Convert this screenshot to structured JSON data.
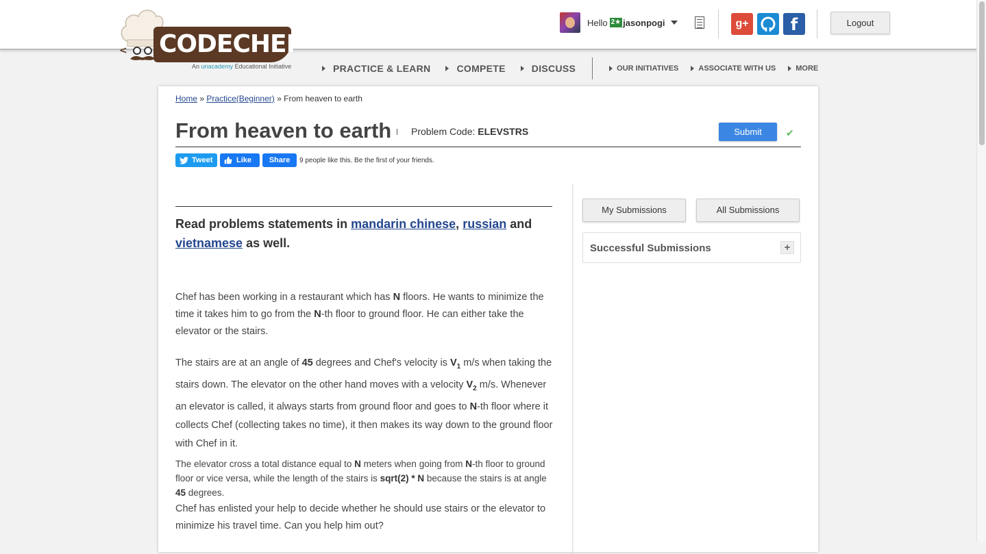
{
  "header": {
    "logo_text": "CODECHEF",
    "tagline_prefix": "An",
    "tagline_brand": "unacademy",
    "tagline_suffix": "Educational Initiative",
    "greeting": "Hello",
    "user_stars": "2★",
    "username": "jasonpogi",
    "logout_label": "Logout",
    "social": {
      "google": "g+",
      "facebook": "f"
    }
  },
  "nav": {
    "primary": [
      "PRACTICE & LEARN",
      "COMPETE",
      "DISCUSS"
    ],
    "secondary": [
      "OUR INITIATIVES",
      "ASSOCIATE WITH US",
      "MORE"
    ]
  },
  "breadcrumb": {
    "home": "Home",
    "sep1": "»",
    "practice": "Practice(Beginner)",
    "sep2": "»",
    "current": "From heaven to earth"
  },
  "problem": {
    "title": "From heaven to earth",
    "code_label": "Problem Code:",
    "code": "ELEVSTRS",
    "submit_label": "Submit"
  },
  "share": {
    "tweet": "Tweet",
    "like": "Like",
    "share": "Share",
    "likes_text": "9 people like this. Be the first of your friends."
  },
  "statement": {
    "read_prefix": "Read problems statements in",
    "lang1": "mandarin chinese",
    "comma": ",",
    "lang2": "russian",
    "and": "and",
    "lang3": "vietnamese",
    "suffix": "as well.",
    "p1": {
      "a": "Chef has been working in a restaurant which has ",
      "n1": "N",
      "b": " floors. He wants to minimize the time it takes him to go from the ",
      "n2": "N",
      "c": "-th floor to ground floor. He can either take the elevator or the stairs."
    },
    "p2": {
      "a": "The stairs are at an angle of ",
      "deg": "45",
      "b": " degrees and Chef's velocity is ",
      "v1": "V",
      "v1sub": "1",
      "c": " m/s when taking the stairs down. The elevator on the other hand moves with a velocity ",
      "v2": "V",
      "v2sub": "2",
      "d": " m/s. Whenever an elevator is called, it always starts from ground floor and goes to ",
      "n": "N",
      "e": "-th floor where it collects Chef (collecting takes no time), it then makes its way down to the ground floor with Chef in it."
    },
    "p3": {
      "a": "The elevator cross a total distance equal to ",
      "n1": "N",
      "b": " meters when going from ",
      "n2": "N",
      "c": "-th floor to ground floor or vice versa, while the length of the stairs is ",
      "expr": "sqrt(2) * N",
      "d": " because the stairs is at angle ",
      "deg": "45",
      "e": " degrees."
    },
    "p4": "Chef has enlisted your help to decide whether he should use stairs or the elevator to minimize his travel time. Can you help him out?"
  },
  "sidebar": {
    "my_submissions": "My Submissions",
    "all_submissions": "All Submissions",
    "successful_submissions": "Successful Submissions",
    "expand": "+"
  },
  "colors": {
    "brand_brown": "#5b3924",
    "link_blue": "#23478e",
    "submit_blue": "#3b86e3",
    "check_green": "#5cb85c"
  }
}
